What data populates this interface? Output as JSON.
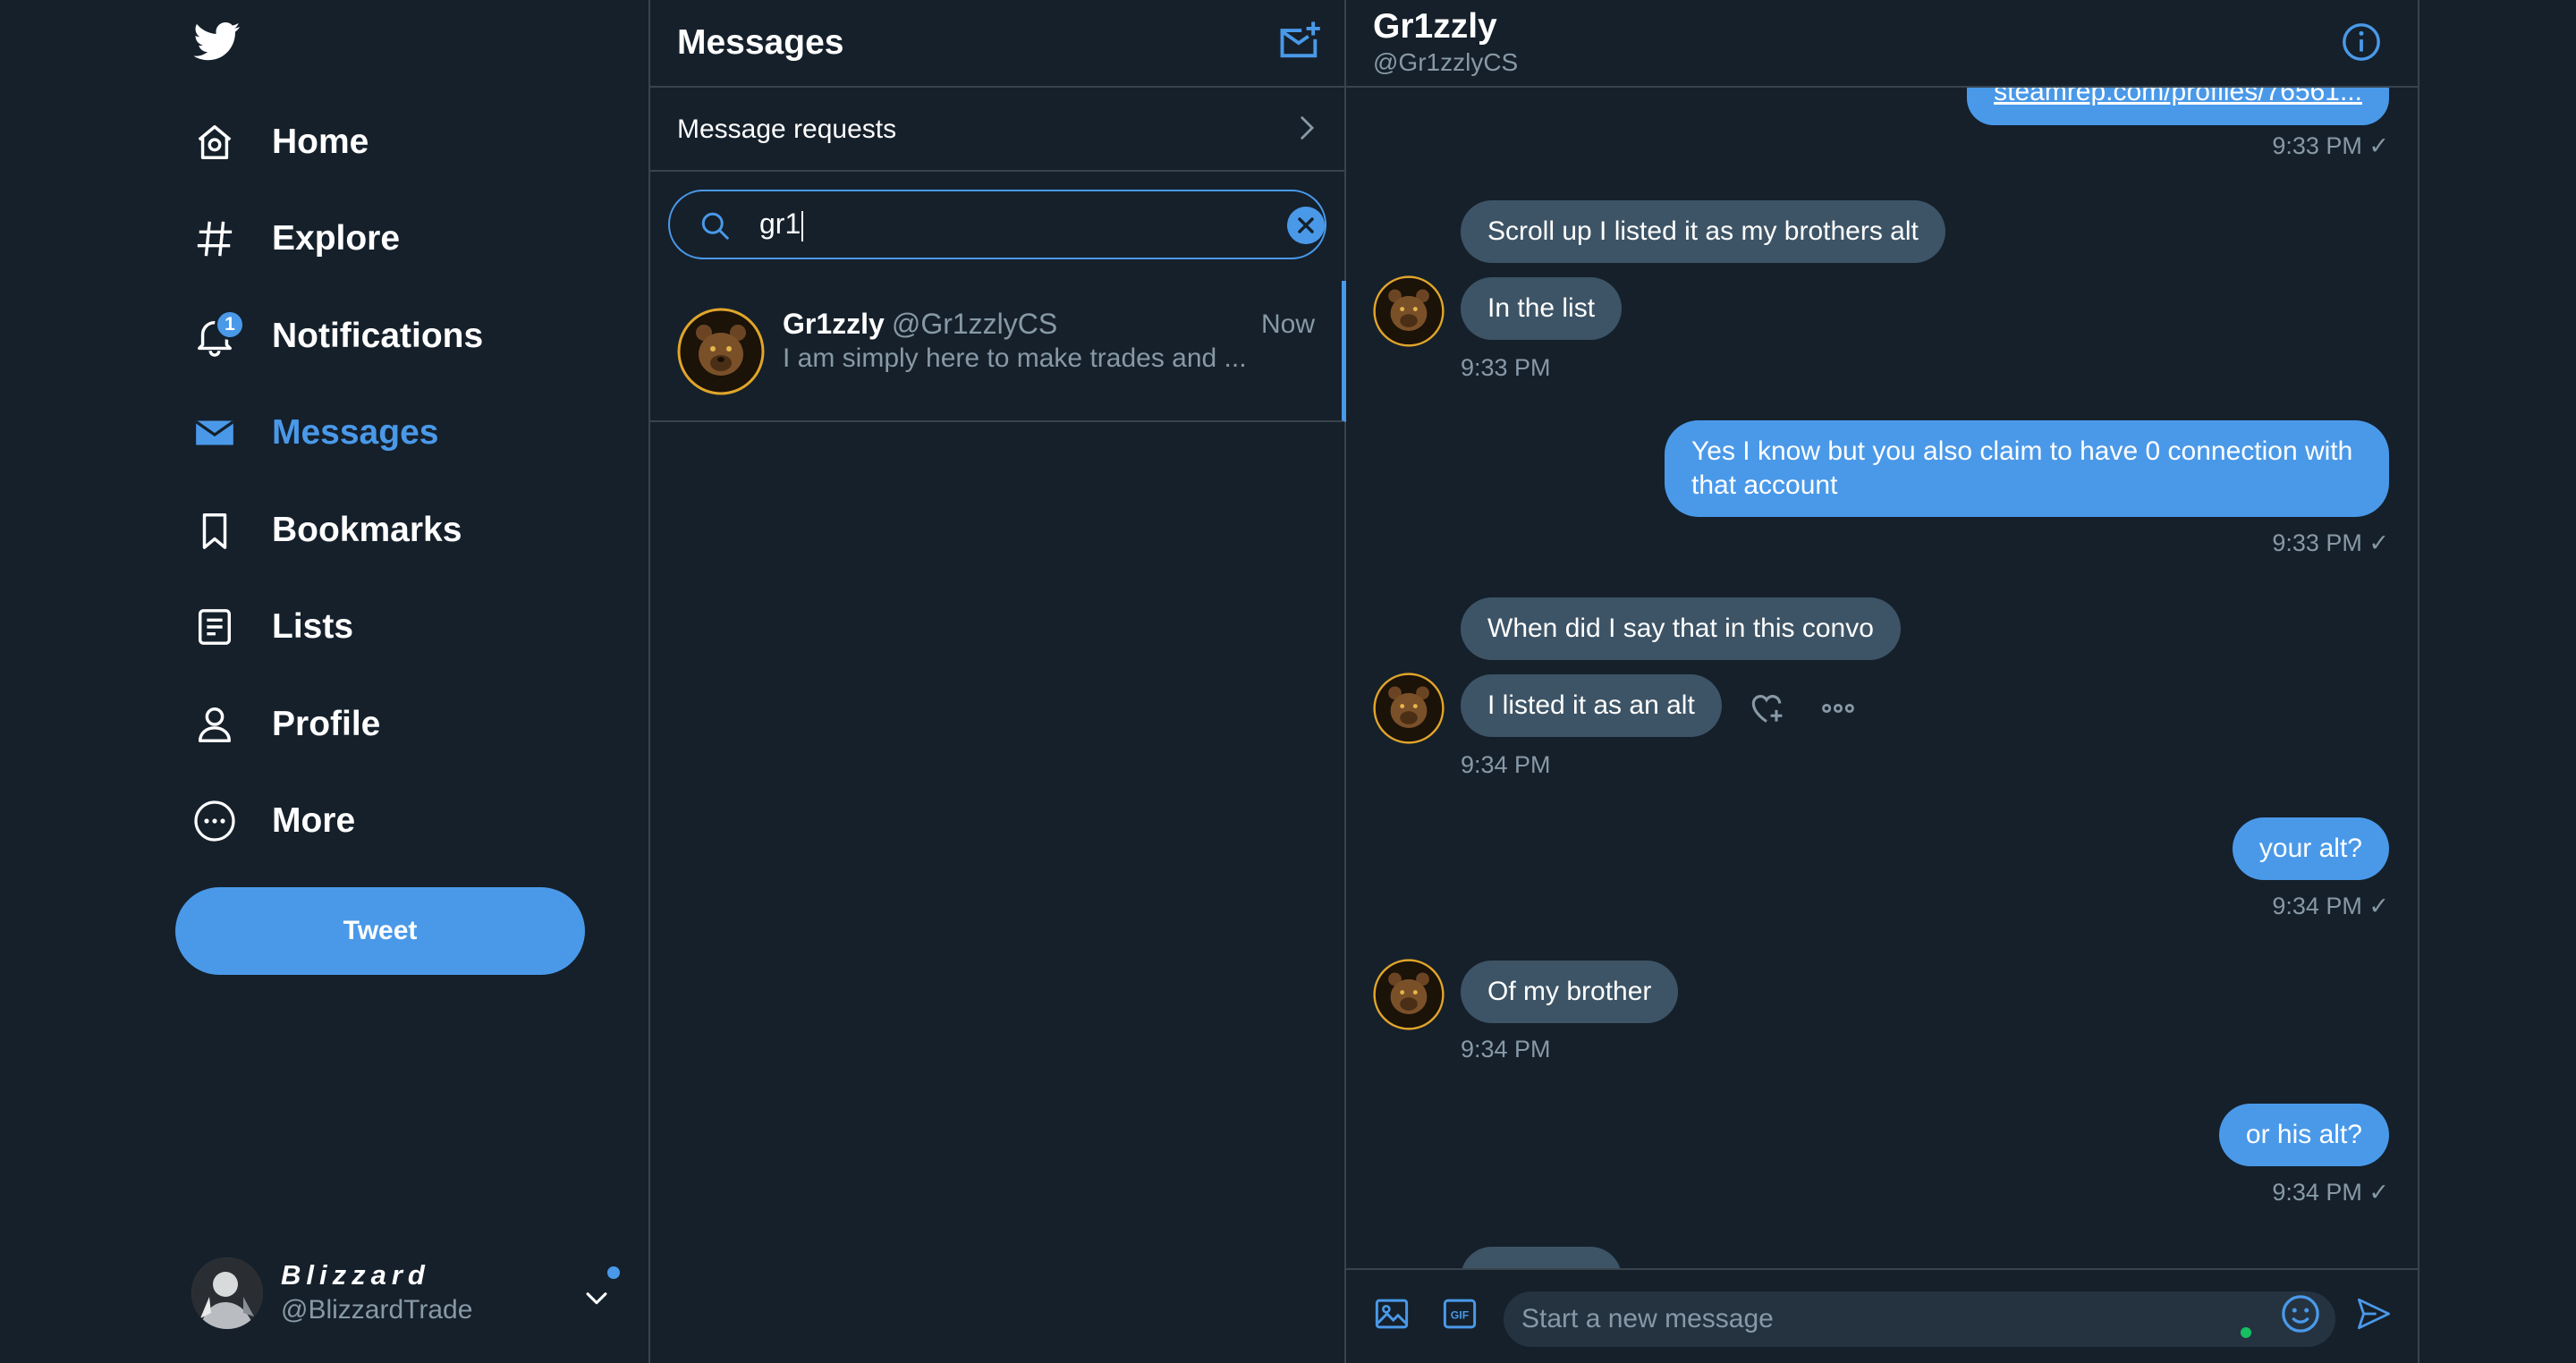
{
  "nav": {
    "items": [
      {
        "label": "Home",
        "icon": "home-icon"
      },
      {
        "label": "Explore",
        "icon": "hashtag-icon"
      },
      {
        "label": "Notifications",
        "icon": "bell-icon",
        "badge": "1"
      },
      {
        "label": "Messages",
        "icon": "envelope-icon",
        "active": true
      },
      {
        "label": "Bookmarks",
        "icon": "bookmark-icon"
      },
      {
        "label": "Lists",
        "icon": "list-icon"
      },
      {
        "label": "Profile",
        "icon": "person-icon"
      },
      {
        "label": "More",
        "icon": "more-circle-icon"
      }
    ],
    "tweet_label": "Tweet",
    "account": {
      "name": "Blizzard",
      "handle": "@BlizzardTrade"
    }
  },
  "messages_panel": {
    "title": "Messages",
    "requests_label": "Message requests",
    "search_value": "gr1",
    "conversation": {
      "name": "Gr1zzly",
      "handle": "@Gr1zzlyCS",
      "time": "Now",
      "preview": "I am simply here to make trades and ..."
    }
  },
  "chat": {
    "name": "Gr1zzly",
    "handle": "@Gr1zzlyCS",
    "messages": [
      {
        "dir": "out",
        "text": "steamrep.com/profiles/76561...",
        "meta": "9:33 PM ✓"
      },
      {
        "dir": "in",
        "text": "Scroll up I listed it as my brothers alt"
      },
      {
        "dir": "in",
        "text": "In the list",
        "meta": "9:33 PM"
      },
      {
        "dir": "out",
        "text": "Yes I know but you also claim to have 0 connection with that account",
        "meta": "9:33 PM ✓"
      },
      {
        "dir": "in",
        "text": "When did I say that in this convo"
      },
      {
        "dir": "in",
        "text": "I listed it as an alt",
        "meta": "9:34 PM"
      },
      {
        "dir": "out",
        "text": "your alt?",
        "meta": "9:34 PM ✓"
      },
      {
        "dir": "in",
        "text": "Of my brother",
        "meta": "9:34 PM"
      },
      {
        "dir": "out",
        "text": "or his alt?",
        "meta": "9:34 PM ✓"
      }
    ],
    "composer_placeholder": "Start a new message"
  },
  "colors": {
    "background": "#15202b",
    "accent": "#4a99e9",
    "incoming_bubble": "#3d5466",
    "border": "#38444d",
    "muted_text": "#8899a6"
  }
}
